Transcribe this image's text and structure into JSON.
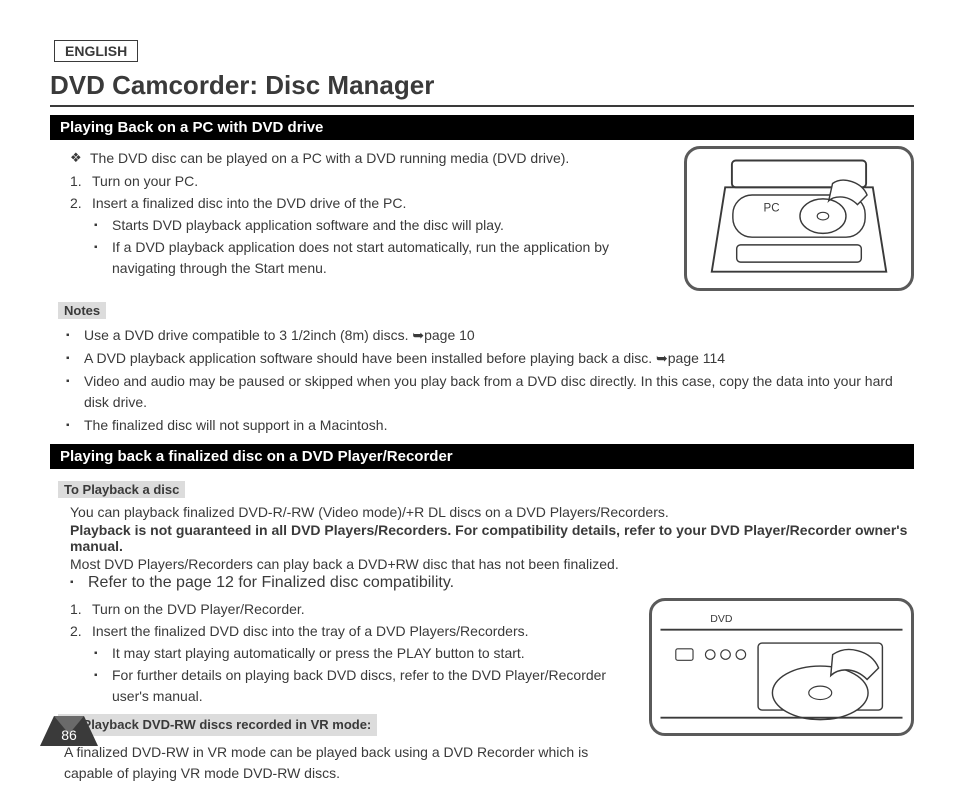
{
  "language_badge": "ENGLISH",
  "page_title": "DVD Camcorder: Disc Manager",
  "section1": {
    "heading": "Playing Back on a PC with DVD drive",
    "intro_bullet": {
      "sym": "❖",
      "text": "The DVD disc can be played on a PC with a DVD running media (DVD drive)."
    },
    "steps": [
      {
        "num": "1.",
        "text": "Turn on your PC."
      },
      {
        "num": "2.",
        "text": "Insert a finalized disc into the DVD drive of the PC."
      }
    ],
    "sub_bullets": [
      {
        "sym": "▪",
        "text": "Starts DVD playback application software and the disc will play."
      },
      {
        "sym": "▪",
        "text": "If a DVD playback application does not start automatically, run the application by navigating through the Start menu."
      }
    ],
    "notes_label": "Notes",
    "notes": [
      {
        "sym": "▪",
        "text": "Use a DVD drive compatible to 3 1/2inch (8m) discs. ➥page 10"
      },
      {
        "sym": "▪",
        "text": "A DVD playback application software should have been installed before playing back a disc. ➥page 114"
      },
      {
        "sym": "▪",
        "text": "Video and audio may be paused or skipped when you play back from a DVD disc directly. In this case, copy the data into your hard disk drive."
      },
      {
        "sym": "▪",
        "text": "The finalized disc will not support in a Macintosh."
      }
    ],
    "illus_label": "PC"
  },
  "section2": {
    "heading": "Playing back a finalized disc on a DVD Player/Recorder",
    "sub1_label": "To Playback a disc",
    "p1": "You can playback finalized DVD-R/-RW (Video mode)/+R DL discs on a DVD Players/Recorders.",
    "p2_bold": "Playback is not guaranteed in all DVD Players/Recorders. For compatibility details, refer to your DVD Player/Recorder owner's manual.",
    "p3": "Most DVD Players/Recorders can play back a DVD+RW disc that has not been finalized.",
    "p3_bullet": {
      "sym": "▪",
      "text": "Refer to the page 12 for Finalized disc compatibility."
    },
    "steps": [
      {
        "num": "1.",
        "text": "Turn on the DVD Player/Recorder."
      },
      {
        "num": "2.",
        "text": "Insert the finalized DVD disc into the tray of a DVD Players/Recorders."
      }
    ],
    "sub_bullets": [
      {
        "sym": "▪",
        "text": "It may start playing automatically or press the PLAY button to start."
      },
      {
        "sym": "▪",
        "text": "For further details on playing back DVD discs, refer to the DVD Player/Recorder user's manual."
      }
    ],
    "sub2_label": "To Playback DVD-RW discs recorded in VR mode:",
    "p4": "A finalized DVD-RW in VR mode can be played back using a DVD Recorder which is capable of playing VR mode DVD-RW discs.",
    "illus_label": "DVD"
  },
  "page_number": "86"
}
